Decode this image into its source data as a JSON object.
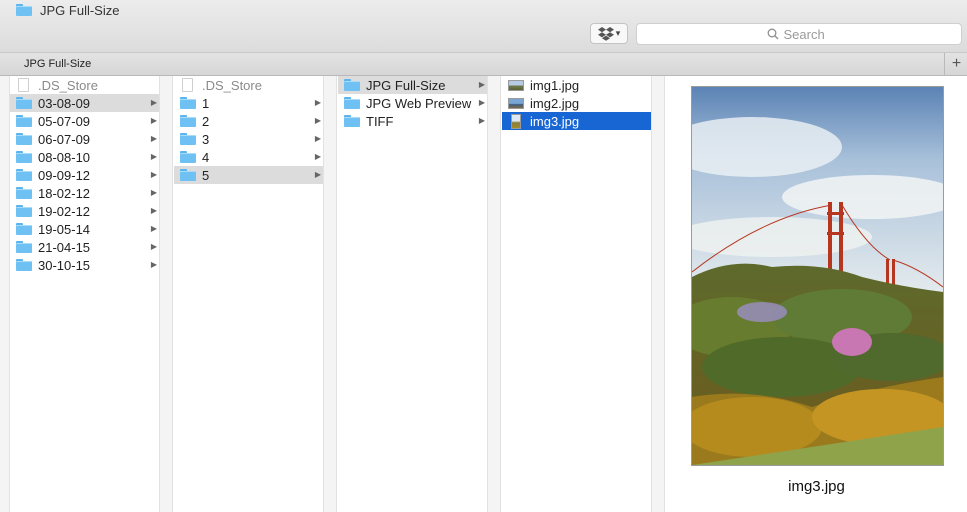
{
  "window": {
    "title": "JPG Full-Size"
  },
  "toolbar": {
    "dropbox_icon": "dropbox-icon",
    "search_placeholder": "Search"
  },
  "tabbar": {
    "tab_label": "JPG Full-Size",
    "add_label": "+"
  },
  "columns": {
    "col1": [
      ".DS_Store",
      "03-08-09",
      "05-07-09",
      "06-07-09",
      "08-08-10",
      "09-09-12",
      "18-02-12",
      "19-02-12",
      "19-05-14",
      "21-04-15",
      "30-10-15"
    ],
    "col2": [
      ".DS_Store",
      "1",
      "2",
      "3",
      "4",
      "5"
    ],
    "col3": [
      "JPG Full-Size",
      "JPG Web Preview",
      "TIFF"
    ],
    "col4": [
      "img1.jpg",
      "img2.jpg",
      "img3.jpg"
    ]
  },
  "selection": {
    "col1": "03-08-09",
    "col2": "5",
    "col3": "JPG Full-Size",
    "col4": "img3.jpg"
  },
  "preview": {
    "filename": "img3.jpg"
  },
  "colors": {
    "selection": "#1866d4",
    "folder": "#6ec1f2"
  }
}
